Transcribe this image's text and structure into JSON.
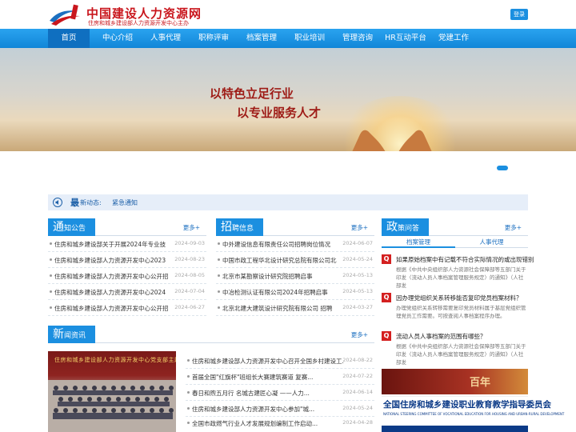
{
  "header": {
    "logo_title": "中国建设人力资源网",
    "logo_subtitle": "住房和城乡建设部人力资源开发中心主办",
    "login_label": "登录"
  },
  "nav": {
    "items": [
      {
        "label": "首页"
      },
      {
        "label": "中心介绍"
      },
      {
        "label": "人事代理"
      },
      {
        "label": "职称评审"
      },
      {
        "label": "档案管理"
      },
      {
        "label": "职业培训"
      },
      {
        "label": "管理咨询"
      },
      {
        "label": "HR互动平台"
      },
      {
        "label": "党建工作"
      }
    ],
    "active_index": 0
  },
  "banner": {
    "line1": "以特色立足行业",
    "line2": "以专业服务人才"
  },
  "ticker": {
    "label_big": "最",
    "label_small": "新动态:",
    "text": "紧急通知"
  },
  "notice": {
    "title_big": "通",
    "title_small": "知公告",
    "more": "更多+",
    "items": [
      {
        "title": "住房和城乡建设部关于开展2024年专业技",
        "date": "2024-09-03"
      },
      {
        "title": "住房和城乡建设部人力资源开发中心2023",
        "date": "2024-08-23"
      },
      {
        "title": "住房和城乡建设部人力资源开发中心公开招",
        "date": "2024-08-05"
      },
      {
        "title": "住房和城乡建设部人力资源开发中心2024",
        "date": "2024-07-04"
      },
      {
        "title": "住房和城乡建设部人力资源开发中心公开招",
        "date": "2024-06-27"
      }
    ]
  },
  "recruit": {
    "title_big": "招",
    "title_small": "聘信息",
    "more": "更多+",
    "items": [
      {
        "title": "中外建设信息有限责任公司招聘岗位情况",
        "date": "2024-06-07"
      },
      {
        "title": "中国市政工程华北设计研究总院有限公司北",
        "date": "2024-05-24"
      },
      {
        "title": "北京市某勘察设计研究院招聘启事",
        "date": "2024-05-13"
      },
      {
        "title": "中冶检测认证有限公司2024年招聘启事",
        "date": "2024-05-13"
      },
      {
        "title": "北京北建大建筑设计研究院有限公司 招聘",
        "date": "2024-03-27"
      }
    ]
  },
  "policy": {
    "title_big": "政",
    "title_small": "策问答",
    "more": "更多+",
    "tabs": [
      {
        "label": "档案管理"
      },
      {
        "label": "人事代理"
      }
    ],
    "active_tab": 0,
    "items": [
      {
        "badge": "Q",
        "title": "如果原始档案中有记载不符合实际情况的或出现错别",
        "body": "根据《中共中央组织部人力资源社会保障部等五部门关于印发〈流动人员人事档案管理服务规定〉的通知》（人社部发"
      },
      {
        "badge": "Q",
        "title": "因办理党组织关系转移能否复印党员档案材料？",
        "body": "办理党组织关系转移需要复印党员材料属于基层党组织管理党员工作需要。可按查阅人事档案程序办理。"
      },
      {
        "badge": "Q",
        "title": "流动人员人事档案的范围有哪些？",
        "body": "根据《中共中央组织部人力资源社会保障部等五部门关于印发〈流动人员人事档案管理服务规定〉的通知》（人社部发"
      }
    ]
  },
  "news": {
    "title_big": "新",
    "title_small": "闻资讯",
    "more": "更多+",
    "photo_caption": "住房和城乡建设部人力资源开发中心党支部主题党日活动",
    "items": [
      {
        "title": "住房和城乡建设部人力资源开发中心召开全国乡村建设工...",
        "date": "2024-08-22"
      },
      {
        "title": "首届全国\"红旗杯\"班组长大赛建筑赛道 复赛...",
        "date": "2024-07-22"
      },
      {
        "title": "春日和煦五月行 名城古建匠心凝 ——人力...",
        "date": "2024-06-14"
      },
      {
        "title": "住房和城乡建设部人力资源开发中心参加\"城...",
        "date": "2024-05-24"
      },
      {
        "title": "全国市政燃气行业人才发展规划编制工作启动...",
        "date": "2024-04-28"
      }
    ]
  },
  "ads": {
    "ad1_text": "百年",
    "ad2_title": "全国住房和城乡建设职业教育教学指导委员会",
    "ad2_sub": "NATIONAL STEERING COMMITTEE OF VOCATIONAL EDUCATION FOR HOUSING AND URBAN-RURAL DEVELOPMENT"
  },
  "colors": {
    "primary_blue": "#1b8fe0",
    "nav_active": "#0f6fc0",
    "brand_red": "#c9161d",
    "q_badge_red": "#d42020"
  }
}
